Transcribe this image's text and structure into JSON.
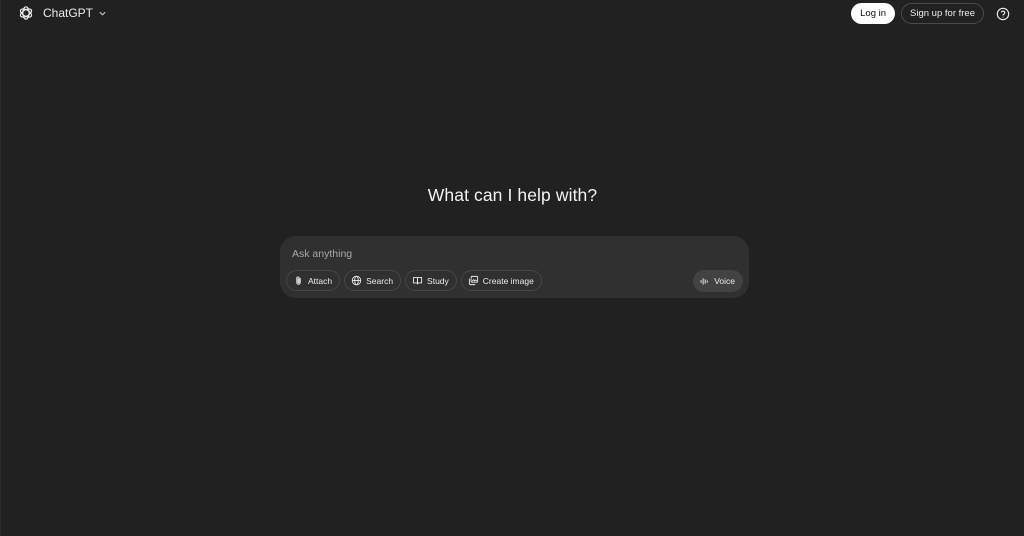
{
  "header": {
    "model_name": "ChatGPT",
    "login_label": "Log in",
    "signup_label": "Sign up for free"
  },
  "main": {
    "headline": "What can I help with?"
  },
  "composer": {
    "placeholder": "Ask anything",
    "tools": [
      {
        "label": "Attach",
        "icon": "paperclip-icon"
      },
      {
        "label": "Search",
        "icon": "globe-icon"
      },
      {
        "label": "Study",
        "icon": "book-icon"
      },
      {
        "label": "Create image",
        "icon": "image-icon"
      }
    ],
    "voice_label": "Voice"
  },
  "colors": {
    "background": "#212121",
    "composer": "#303030",
    "voice_button": "#424242",
    "login_button": "#ffffff"
  }
}
